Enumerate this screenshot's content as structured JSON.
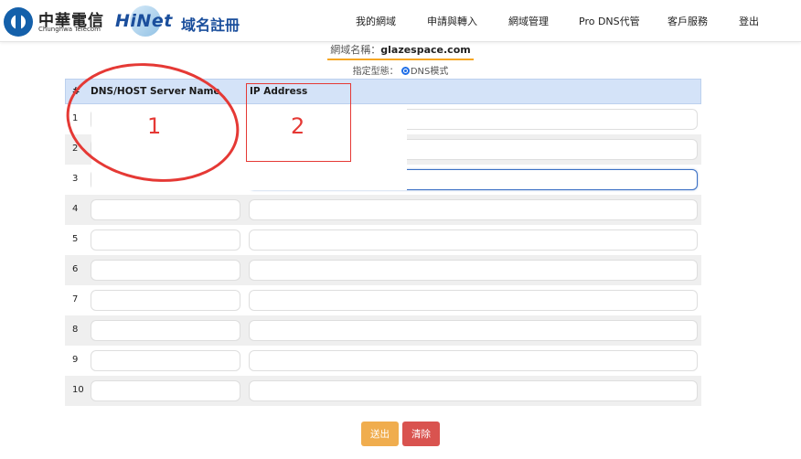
{
  "header": {
    "company_cn": "中華電信",
    "company_en": "Chunghwa Telecom",
    "brand": "HiNet",
    "brand_sub": "域名註冊"
  },
  "nav": [
    {
      "label": "我的網域"
    },
    {
      "label": "申請與轉入"
    },
    {
      "label": "網域管理"
    },
    {
      "label": "Pro DNS代管"
    },
    {
      "label": "客戶服務"
    },
    {
      "label": "登出"
    }
  ],
  "domain": {
    "label": "網域名稱：",
    "value": "glazespace.com"
  },
  "type": {
    "label": "指定型態：",
    "option": "DNS模式"
  },
  "table": {
    "headers": [
      "#",
      "DNS/HOST Server Name",
      "IP Address"
    ],
    "rows": [
      "1",
      "2",
      "3",
      "4",
      "5",
      "6",
      "7",
      "8",
      "9",
      "10"
    ]
  },
  "annotations": {
    "circle_label": "1",
    "box_label": "2"
  },
  "buttons": {
    "submit": "送出",
    "clear": "清除"
  },
  "colors": {
    "header_row": "#d4e3f8",
    "annotation": "#e53935",
    "submit": "#f0ad4e",
    "clear": "#d9534f",
    "underline": "#f5a623"
  }
}
